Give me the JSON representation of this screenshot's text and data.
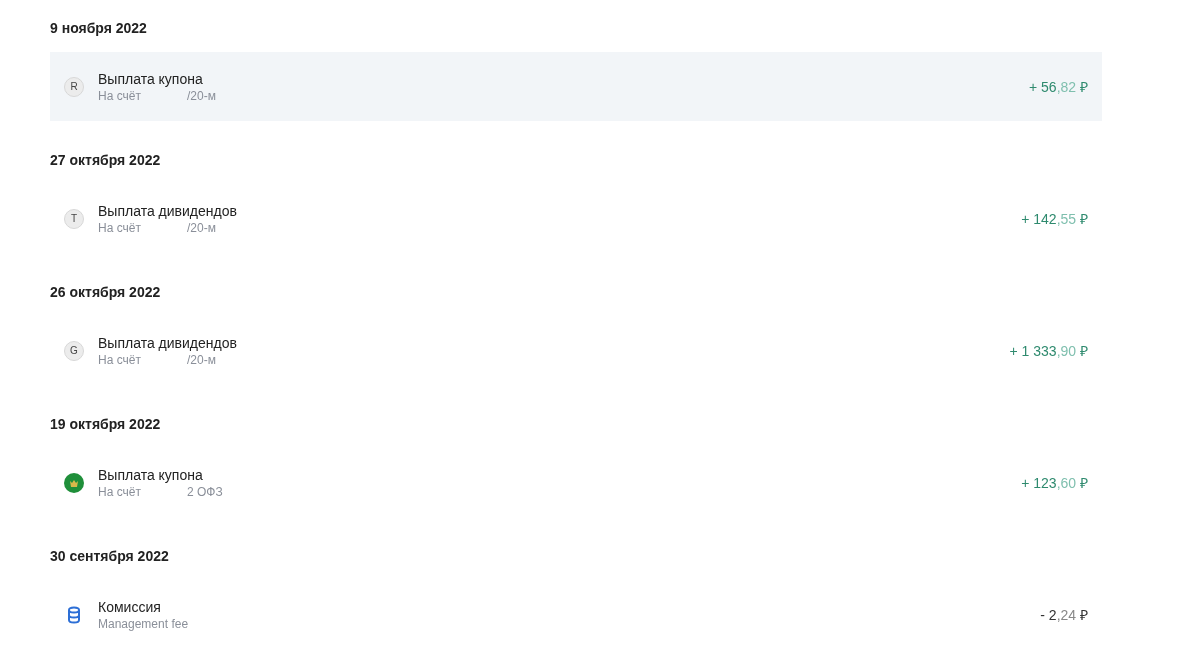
{
  "groups": [
    {
      "date": "9 ноября 2022",
      "operations": [
        {
          "selected": true,
          "icon": {
            "kind": "letter",
            "text": "R"
          },
          "title": "Выплата купона",
          "subtitle": {
            "prefix": "На счёт",
            "suffix": "/20-м"
          },
          "amount": {
            "kind": "income",
            "whole": "+ 56",
            "fraction": ",82",
            "currency": "₽"
          }
        }
      ]
    },
    {
      "date": "27 октября 2022",
      "operations": [
        {
          "selected": false,
          "icon": {
            "kind": "letter",
            "text": "T"
          },
          "title": "Выплата дивидендов",
          "subtitle": {
            "prefix": "На счёт",
            "suffix": "/20-м"
          },
          "amount": {
            "kind": "income",
            "whole": "+ 142",
            "fraction": ",55",
            "currency": "₽"
          }
        }
      ]
    },
    {
      "date": "26 октября 2022",
      "operations": [
        {
          "selected": false,
          "icon": {
            "kind": "letter",
            "text": "G"
          },
          "title": "Выплата дивидендов",
          "subtitle": {
            "prefix": "На счёт",
            "suffix": "/20-м"
          },
          "amount": {
            "kind": "income",
            "whole": "+ 1 333",
            "fraction": ",90",
            "currency": "₽"
          }
        }
      ]
    },
    {
      "date": "19 октября 2022",
      "operations": [
        {
          "selected": false,
          "icon": {
            "kind": "emblem"
          },
          "title": "Выплата купона",
          "subtitle": {
            "prefix": "На счёт",
            "suffix": "2 ОФЗ"
          },
          "amount": {
            "kind": "income",
            "whole": "+ 123",
            "fraction": ",60",
            "currency": "₽"
          }
        }
      ]
    },
    {
      "date": "30 сентября 2022",
      "operations": [
        {
          "selected": false,
          "icon": {
            "kind": "coins"
          },
          "title": "Комиссия",
          "subtitle": {
            "prefix": "Management fee"
          },
          "amount": {
            "kind": "expense",
            "whole": "- 2",
            "fraction": ",24",
            "currency": "₽"
          }
        }
      ]
    }
  ]
}
